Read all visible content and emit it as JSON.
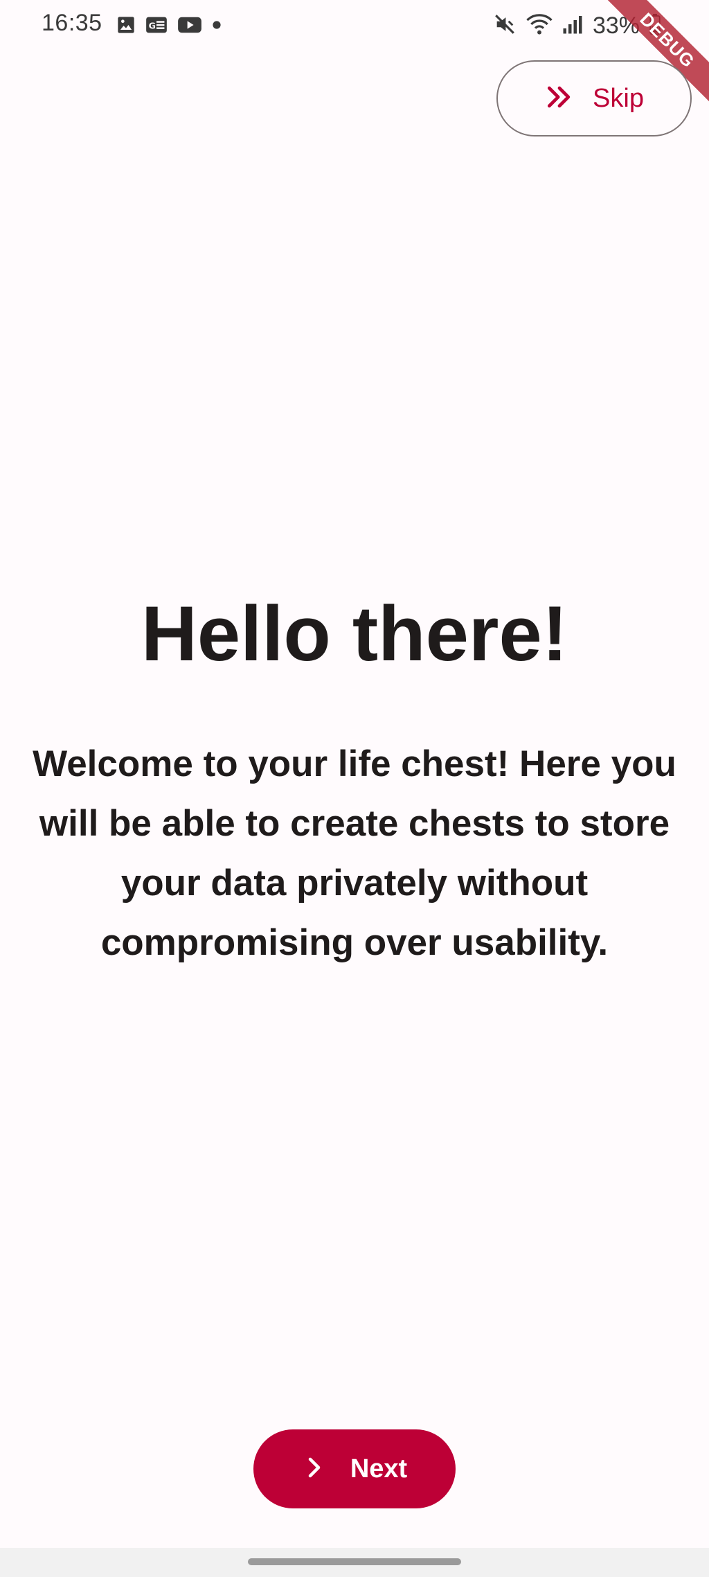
{
  "status_bar": {
    "time": "16:35",
    "battery": "33%",
    "left_icons": [
      "image-icon",
      "news-icon",
      "youtube-icon",
      "dot-icon"
    ],
    "right_icons": [
      "mute-icon",
      "wifi-icon",
      "signal-icon",
      "battery-icon"
    ]
  },
  "debug_banner": {
    "label": "DEBUG"
  },
  "skip_button": {
    "label": "Skip",
    "icon": "double-chevron-right-icon"
  },
  "onboarding": {
    "title": "Hello there!",
    "description": "Welcome to your life chest! Here you will be able to create chests to store your data privately without compromising over usability."
  },
  "next_button": {
    "label": "Next",
    "icon": "chevron-right-icon"
  },
  "colors": {
    "accent": "#bd0036",
    "background": "#fffbfd",
    "text": "#1f1b1b",
    "outline": "#7f7576"
  }
}
